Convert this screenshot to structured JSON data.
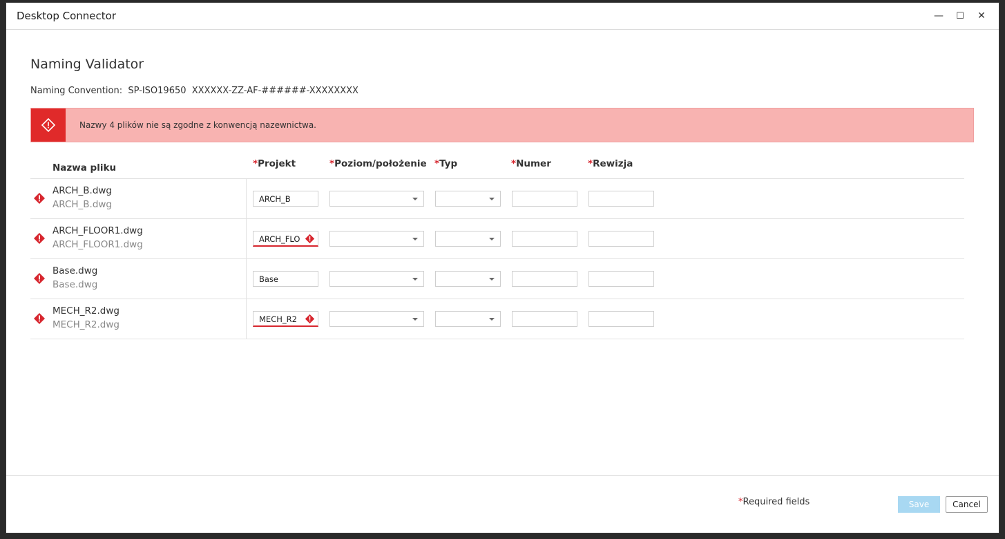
{
  "window": {
    "title": "Desktop Connector",
    "minimize": "—",
    "maximize": "☐",
    "close": "✕"
  },
  "heading": "Naming Validator",
  "convention": {
    "label": "Naming Convention:",
    "standard": "SP-ISO19650",
    "pattern": "XXXXXX-ZZ-AF-######-XXXXXXXX"
  },
  "banner": {
    "message": "Nazwy 4 plików nie są zgodne z konwencją nazewnictwa.",
    "color": "#f8b3b1",
    "icon_color": "#e02a2a"
  },
  "columns": {
    "file": "Nazwa pliku",
    "project": "Projekt",
    "level": "Poziom/położenie",
    "type": "Typ",
    "number": "Numer",
    "revision": "Rewizja",
    "required_marker": "*"
  },
  "rows": [
    {
      "name": "ARCH_B.dwg",
      "original": "ARCH_B.dwg",
      "project": "ARCH_B",
      "project_invalid": false
    },
    {
      "name": "ARCH_FLOOR1.dwg",
      "original": "ARCH_FLOOR1.dwg",
      "project": "ARCH_FLO",
      "project_invalid": true
    },
    {
      "name": "Base.dwg",
      "original": "Base.dwg",
      "project": "Base",
      "project_invalid": false
    },
    {
      "name": "MECH_R2.dwg",
      "original": "MECH_R2.dwg",
      "project": "MECH_R2",
      "project_invalid": true
    }
  ],
  "footer": {
    "required_marker": "*",
    "required_text": "Required fields",
    "save": "Save",
    "cancel": "Cancel"
  },
  "icons": {
    "error": "error-diamond-icon",
    "caret": "chevron-down-icon"
  },
  "colors": {
    "error": "#d7262e",
    "save_disabled": "#a8d8f2"
  }
}
